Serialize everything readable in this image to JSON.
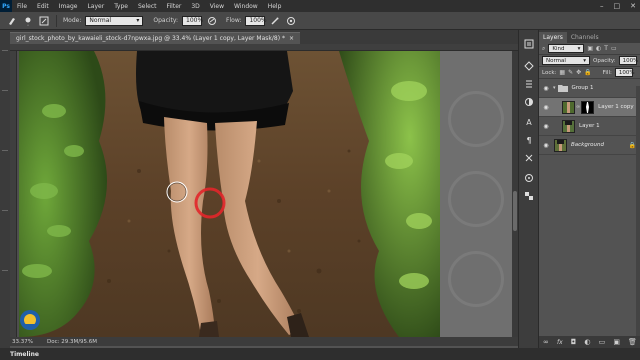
{
  "menubar": {
    "logo": "Ps",
    "items": [
      "File",
      "Edit",
      "Image",
      "Layer",
      "Type",
      "Select",
      "Filter",
      "3D",
      "View",
      "Window",
      "Help"
    ],
    "controls": [
      "–",
      "□",
      "✕"
    ]
  },
  "options": {
    "mode_label": "Mode:",
    "mode_value": "Normal",
    "opacity_label": "Opacity:",
    "opacity_value": "100%",
    "flow_label": "Flow:",
    "flow_value": "100%"
  },
  "document": {
    "tab_title": "girl_stock_photo_by_kawaieli_stock-d7npwxa.jpg @ 33.4% (Layer 1 copy, Layer Mask/8) *",
    "close": "×"
  },
  "status": {
    "zoom": "33.37%",
    "doc_size": "Doc: 29.3M/95.6M"
  },
  "timeline": {
    "label": "Timeline"
  },
  "layers_panel": {
    "tabs": [
      "Layers",
      "Channels"
    ],
    "kind_label": "Kind",
    "blend_mode": "Normal",
    "opacity_label": "Opacity:",
    "opacity_value": "100%",
    "lock_label": "Lock:",
    "fill_label": "Fill:",
    "fill_value": "100%",
    "layers": [
      {
        "name": "Group 1",
        "type": "group"
      },
      {
        "name": "Layer 1 copy",
        "type": "masked",
        "selected": true
      },
      {
        "name": "Layer 1",
        "type": "pixel"
      },
      {
        "name": "Background",
        "type": "background",
        "locked": true
      }
    ],
    "footer_icons": [
      "link-icon",
      "fx-icon",
      "mask-icon",
      "adjustment-icon",
      "folder-icon",
      "new-layer-icon",
      "trash-icon"
    ]
  },
  "colors": {
    "app_bg": "#535353",
    "menubar": "#2f2f2f",
    "selected_layer": "#737373"
  }
}
